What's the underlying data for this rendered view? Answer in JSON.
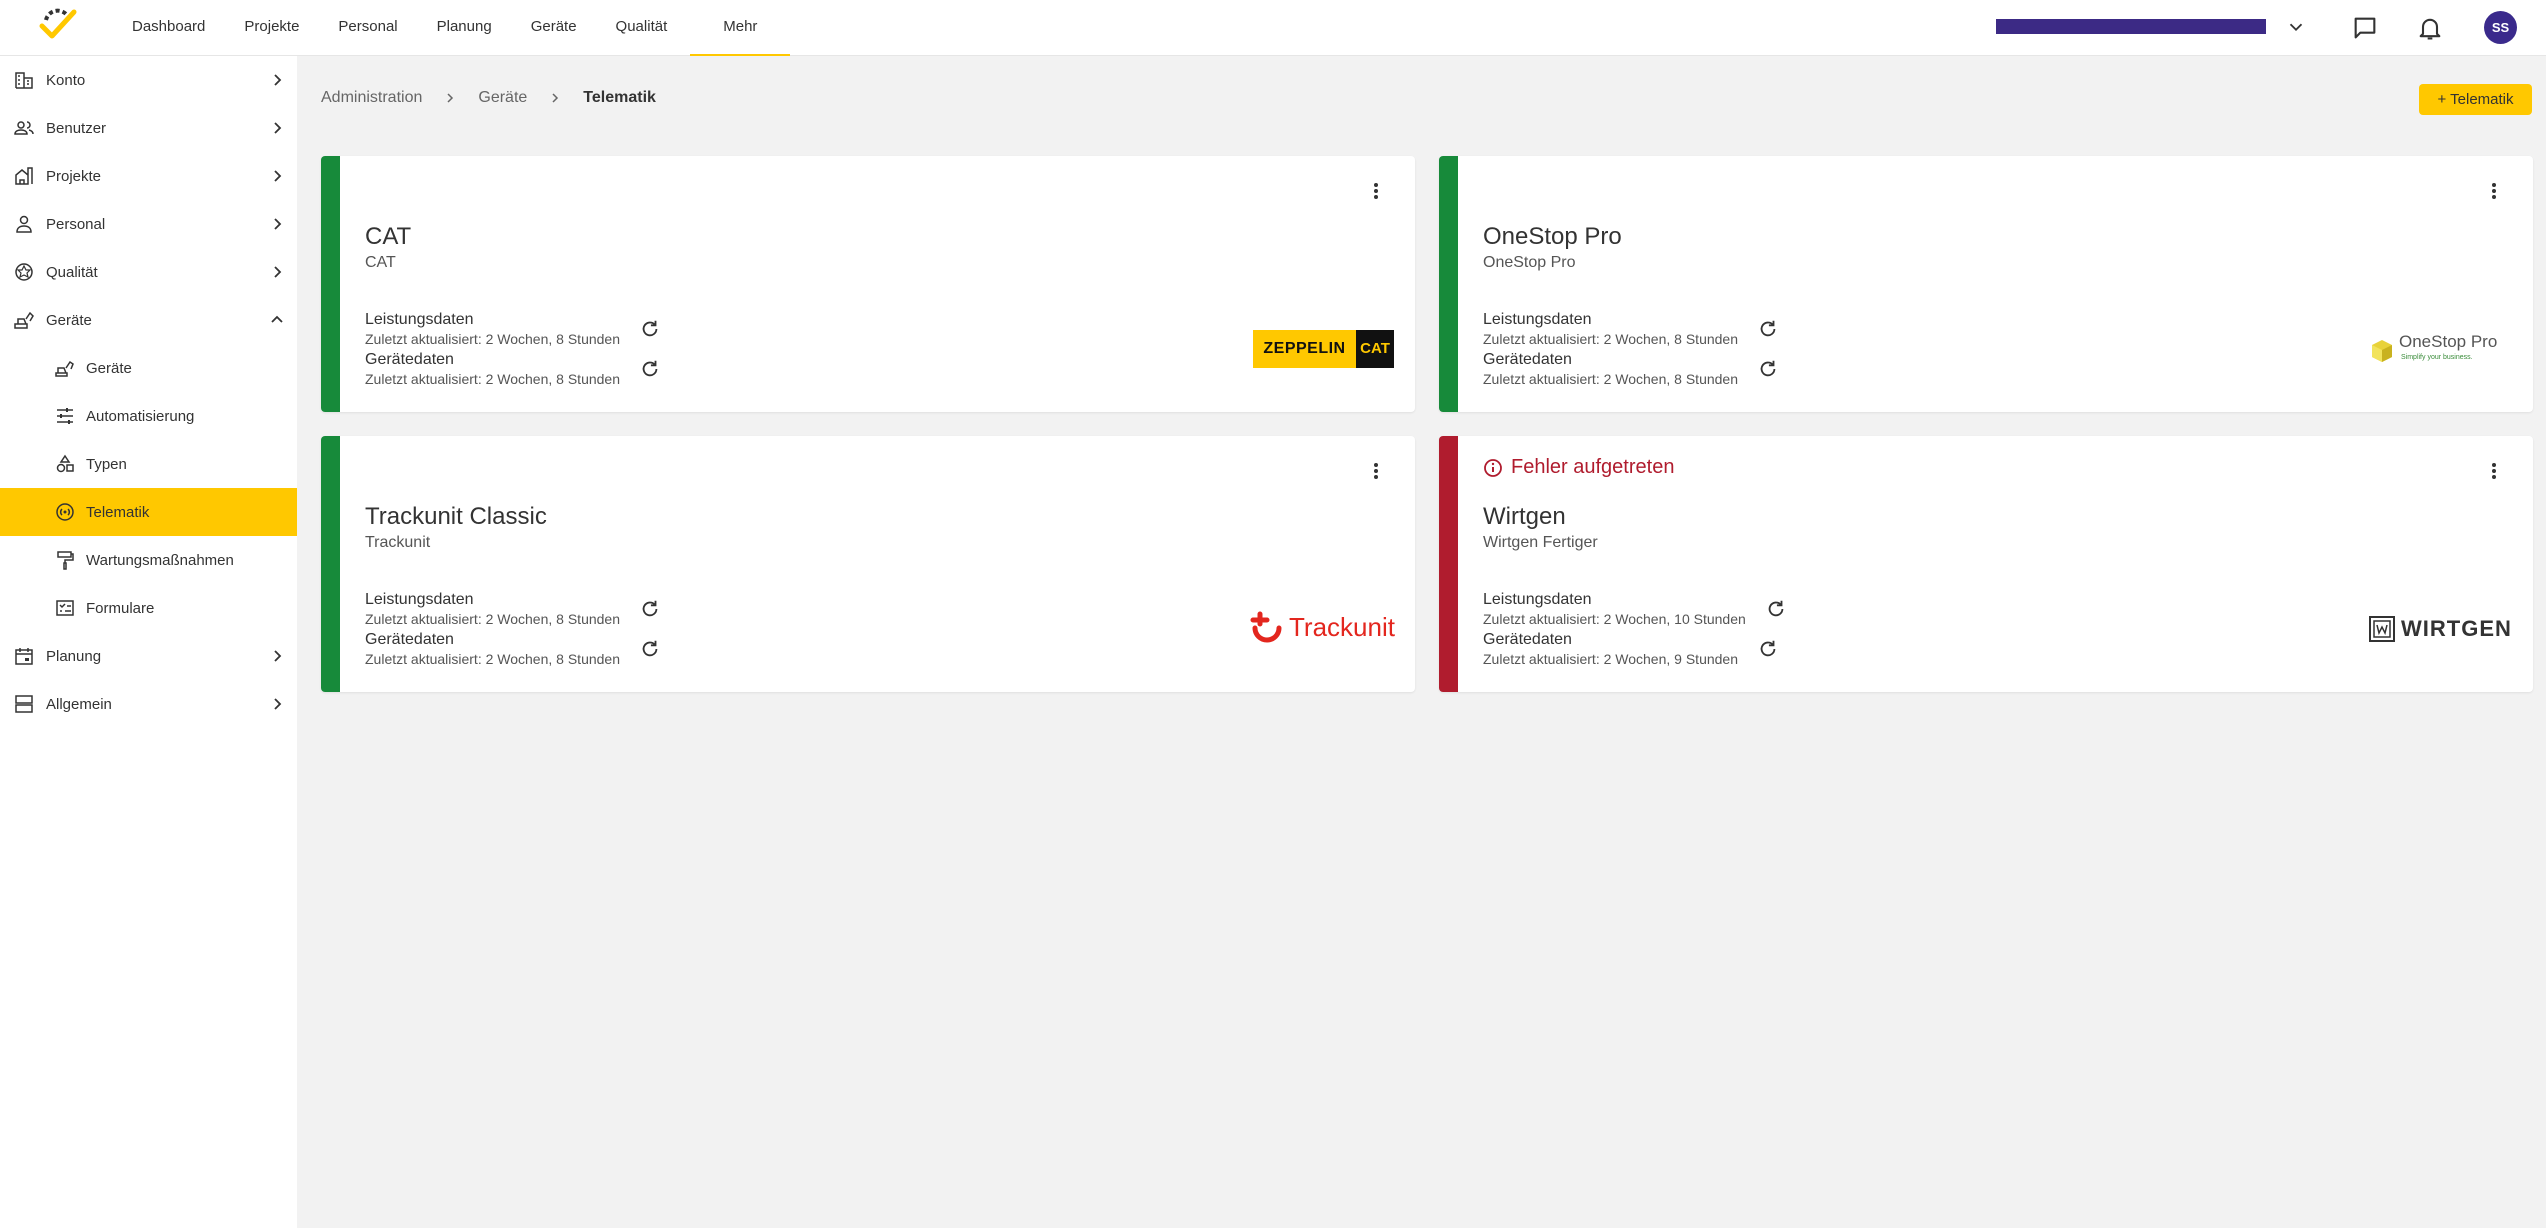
{
  "topnav": {
    "items": [
      "Dashboard",
      "Projekte",
      "Personal",
      "Planung",
      "Geräte",
      "Qualität",
      "Mehr"
    ],
    "active": "Mehr"
  },
  "user": {
    "initials": "SS"
  },
  "sidebar": {
    "items": [
      {
        "label": "Konto",
        "icon": "building-icon"
      },
      {
        "label": "Benutzer",
        "icon": "users-icon"
      },
      {
        "label": "Projekte",
        "icon": "projects-icon"
      },
      {
        "label": "Personal",
        "icon": "person-icon"
      },
      {
        "label": "Qualität",
        "icon": "quality-icon"
      },
      {
        "label": "Geräte",
        "icon": "equipment-icon",
        "expanded": true
      },
      {
        "label": "Planung",
        "icon": "calendar-icon"
      },
      {
        "label": "Allgemein",
        "icon": "storage-icon"
      }
    ],
    "sub_items": [
      {
        "label": "Geräte",
        "icon": "excavator-icon"
      },
      {
        "label": "Automatisierung",
        "icon": "tune-icon"
      },
      {
        "label": "Typen",
        "icon": "shapes-icon"
      },
      {
        "label": "Telematik",
        "icon": "telematics-icon",
        "active": true
      },
      {
        "label": "Wartungsmaßnahmen",
        "icon": "paint-roller-icon"
      },
      {
        "label": "Formulare",
        "icon": "form-icon"
      }
    ]
  },
  "breadcrumb": [
    "Administration",
    "Geräte",
    "Telematik"
  ],
  "add_button": {
    "label": "Telematik"
  },
  "cards": [
    {
      "title": "CAT",
      "subtitle": "CAT",
      "status": "ok",
      "leistung_label": "Leistungsdaten",
      "leistung_sub": "Zuletzt aktualisiert: 2 Wochen, 8 Stunden",
      "geraete_label": "Gerätedaten",
      "geraete_sub": "Zuletzt aktualisiert: 2 Wochen, 8 Stunden",
      "logo": {
        "text": "ZEPPELIN",
        "badge": "CAT"
      }
    },
    {
      "title": "OneStop Pro",
      "subtitle": "OneStop Pro",
      "status": "ok",
      "leistung_label": "Leistungsdaten",
      "leistung_sub": "Zuletzt aktualisiert: 2 Wochen, 8 Stunden",
      "geraete_label": "Gerätedaten",
      "geraete_sub": "Zuletzt aktualisiert: 2 Wochen, 8 Stunden",
      "logo": {
        "text": "OneStop Pro",
        "tagline": "Simplify your business."
      }
    },
    {
      "title": "Trackunit Classic",
      "subtitle": "Trackunit",
      "status": "ok",
      "leistung_label": "Leistungsdaten",
      "leistung_sub": "Zuletzt aktualisiert: 2 Wochen, 8 Stunden",
      "geraete_label": "Gerätedaten",
      "geraete_sub": "Zuletzt aktualisiert: 2 Wochen, 8 Stunden",
      "logo": {
        "text": "Trackunit"
      }
    },
    {
      "title": "Wirtgen",
      "subtitle": "Wirtgen Fertiger",
      "status": "error",
      "error_text": "Fehler aufgetreten",
      "leistung_label": "Leistungsdaten",
      "leistung_sub": "Zuletzt aktualisiert: 2 Wochen, 10 Stunden",
      "geraete_label": "Gerätedaten",
      "geraete_sub": "Zuletzt aktualisiert: 2 Wochen, 9 Stunden",
      "logo": {
        "text": "WIRTGEN"
      }
    }
  ],
  "colors": {
    "accent": "#ffc800",
    "ok": "#178a3a",
    "error": "#b01c2e",
    "brand": "#3c2a85"
  }
}
